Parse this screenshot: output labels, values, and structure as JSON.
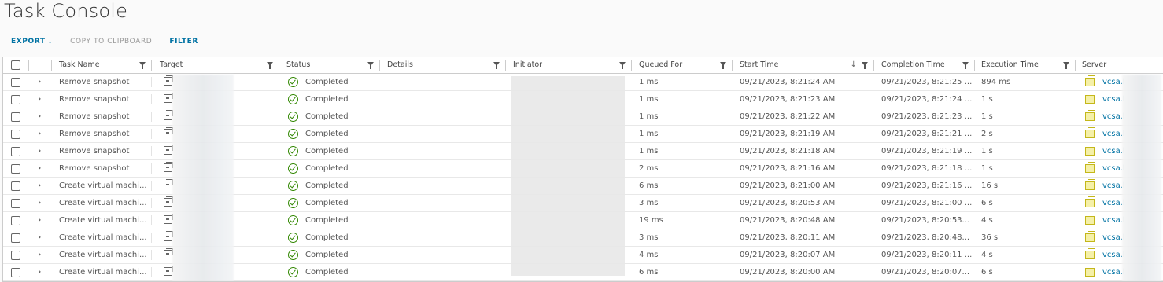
{
  "page": {
    "title": "Task Console"
  },
  "toolbar": {
    "export_label": "EXPORT",
    "copy_label": "COPY TO CLIPBOARD",
    "filter_label": "FILTER"
  },
  "columns": [
    "Task Name",
    "Target",
    "Status",
    "Details",
    "Initiator",
    "Queued For",
    "Start Time",
    "Completion Time",
    "Execution Time",
    "Server"
  ],
  "rows": [
    {
      "task": "Remove snapshot",
      "status": "Completed",
      "queued": "1 ms",
      "start": "09/21/2023, 8:21:24 AM",
      "completion": "09/21/2023, 8:21:25 ...",
      "exec": "894 ms",
      "server": "vcsa.l"
    },
    {
      "task": "Remove snapshot",
      "status": "Completed",
      "queued": "1 ms",
      "start": "09/21/2023, 8:21:23 AM",
      "completion": "09/21/2023, 8:21:24 ...",
      "exec": "1 s",
      "server": "vcsa.l"
    },
    {
      "task": "Remove snapshot",
      "status": "Completed",
      "queued": "1 ms",
      "start": "09/21/2023, 8:21:22 AM",
      "completion": "09/21/2023, 8:21:23 ...",
      "exec": "1 s",
      "server": "vcsa.l"
    },
    {
      "task": "Remove snapshot",
      "status": "Completed",
      "queued": "1 ms",
      "start": "09/21/2023, 8:21:19 AM",
      "completion": "09/21/2023, 8:21:21 ...",
      "exec": "2 s",
      "server": "vcsa.l"
    },
    {
      "task": "Remove snapshot",
      "status": "Completed",
      "queued": "1 ms",
      "start": "09/21/2023, 8:21:18 AM",
      "completion": "09/21/2023, 8:21:19 ...",
      "exec": "1 s",
      "server": "vcsa.l"
    },
    {
      "task": "Remove snapshot",
      "status": "Completed",
      "queued": "2 ms",
      "start": "09/21/2023, 8:21:16 AM",
      "completion": "09/21/2023, 8:21:18 ...",
      "exec": "1 s",
      "server": "vcsa.l"
    },
    {
      "task": "Create virtual machi...",
      "status": "Completed",
      "queued": "6 ms",
      "start": "09/21/2023, 8:21:00 AM",
      "completion": "09/21/2023, 8:21:16 ...",
      "exec": "16 s",
      "server": "vcsa.l"
    },
    {
      "task": "Create virtual machi...",
      "status": "Completed",
      "queued": "3 ms",
      "start": "09/21/2023, 8:20:53 AM",
      "completion": "09/21/2023, 8:21:00 ...",
      "exec": "6 s",
      "server": "vcsa.l"
    },
    {
      "task": "Create virtual machi...",
      "status": "Completed",
      "queued": "19 ms",
      "start": "09/21/2023, 8:20:48 AM",
      "completion": "09/21/2023, 8:20:53...",
      "exec": "4 s",
      "server": "vcsa.l"
    },
    {
      "task": "Create virtual machi...",
      "status": "Completed",
      "queued": "3 ms",
      "start": "09/21/2023, 8:20:11 AM",
      "completion": "09/21/2023, 8:20:48...",
      "exec": "36 s",
      "server": "vcsa.l"
    },
    {
      "task": "Create virtual machi...",
      "status": "Completed",
      "queued": "4 ms",
      "start": "09/21/2023, 8:20:07 AM",
      "completion": "09/21/2023, 8:20:11 ...",
      "exec": "4 s",
      "server": "vcsa.l"
    },
    {
      "task": "Create virtual machi...",
      "status": "Completed",
      "queued": "6 ms",
      "start": "09/21/2023, 8:20:00 AM",
      "completion": "09/21/2023, 8:20:07...",
      "exec": "6 s",
      "server": "vcsa.l"
    }
  ],
  "colors": {
    "link": "#0072a3",
    "ok": "#318700"
  },
  "icons": {
    "status": "check-circle-icon",
    "target": "vm-icon",
    "server": "vcenter-icon"
  }
}
